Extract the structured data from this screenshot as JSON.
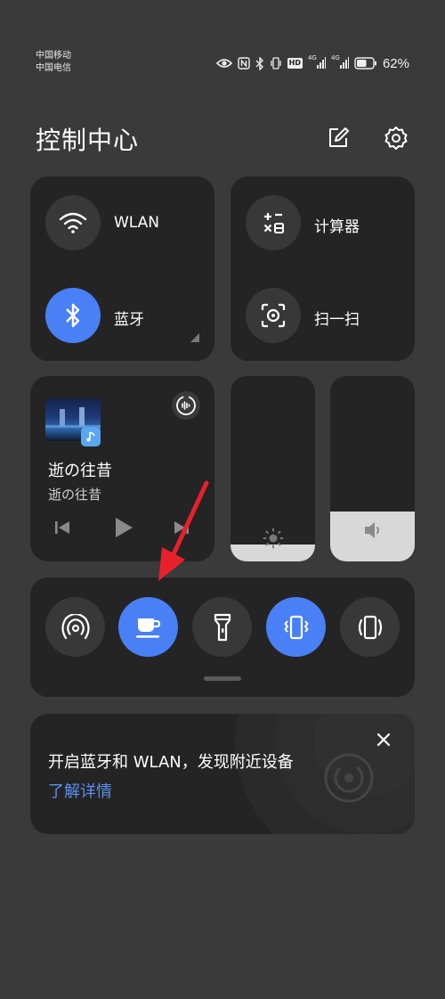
{
  "status_bar": {
    "carrier_1": "中国移动",
    "carrier_2": "中国电信",
    "hd_label": "HD",
    "net_1": "4G",
    "net_2": "4G",
    "battery_percent": "62%",
    "battery_level": 0.62
  },
  "header": {
    "title": "控制中心",
    "edit_icon": "edit-icon",
    "settings_icon": "gear-icon"
  },
  "tiles": {
    "wlan": {
      "label": "WLAN",
      "icon": "wifi-icon",
      "active": false
    },
    "bluetooth": {
      "label": "蓝牙",
      "icon": "bluetooth-icon",
      "active": true
    },
    "calculator": {
      "label": "计算器",
      "icon": "calculator-icon"
    },
    "scan": {
      "label": "扫一扫",
      "icon": "scan-icon"
    }
  },
  "media": {
    "title": "逝の往昔",
    "artist": "逝の往昔",
    "controls": [
      "previous-icon",
      "play-icon",
      "next-icon"
    ]
  },
  "sliders": {
    "brightness": {
      "icon": "brightness-icon",
      "level": 0.09
    },
    "volume": {
      "icon": "volume-icon",
      "level": 0.27
    }
  },
  "toggles": [
    {
      "icon": "hotspot-icon",
      "active": false
    },
    {
      "icon": "coffee-cup-icon",
      "active": true
    },
    {
      "icon": "flashlight-icon",
      "active": false
    },
    {
      "icon": "vibrate-icon",
      "active": true
    },
    {
      "icon": "rotation-icon",
      "active": false
    }
  ],
  "hint_card": {
    "text": "开启蓝牙和 WLAN，发现附近设备",
    "link": "了解详情"
  },
  "colors": {
    "accent": "#4a80f5",
    "background": "#3a3a3a",
    "panel": "#242424",
    "annotation_arrow": "#e8202a"
  }
}
